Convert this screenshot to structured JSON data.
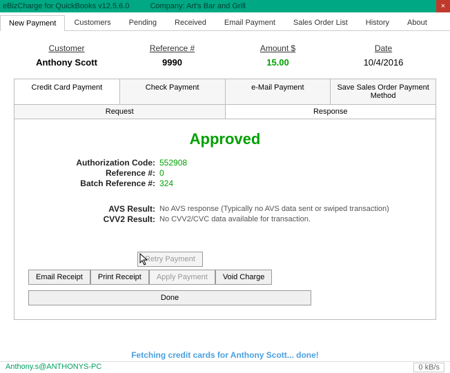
{
  "window": {
    "title1": "eBizCharge for QuickBooks v12.5.6.0",
    "title2": "Company: Art's Bar and Grill",
    "close": "×"
  },
  "main_tabs": [
    {
      "label": "New Payment",
      "active": true
    },
    {
      "label": "Customers",
      "active": false
    },
    {
      "label": "Pending",
      "active": false
    },
    {
      "label": "Received",
      "active": false
    },
    {
      "label": "Email Payment",
      "active": false
    },
    {
      "label": "Sales Order List",
      "active": false
    },
    {
      "label": "History",
      "active": false
    },
    {
      "label": "About",
      "active": false
    }
  ],
  "summary": {
    "customer_head": "Customer",
    "customer_val": "Anthony Scott",
    "ref_head": "Reference #",
    "ref_val": "9990",
    "amount_head": "Amount $",
    "amount_val": "15.00",
    "date_head": "Date",
    "date_val": "10/4/2016"
  },
  "pay_tabs": [
    {
      "label": "Credit Card Payment",
      "active": true
    },
    {
      "label": "Check Payment",
      "active": false
    },
    {
      "label": "e-Mail Payment",
      "active": false
    },
    {
      "label": "Save Sales Order Payment Method",
      "active": false
    }
  ],
  "sub_tabs": [
    {
      "label": "Request",
      "active": false
    },
    {
      "label": "Response",
      "active": true
    }
  ],
  "response": {
    "status": "Approved",
    "rows": [
      {
        "lbl": "Authorization Code:",
        "val": "552908",
        "cls": "val"
      },
      {
        "lbl": "Reference #:",
        "val": "0",
        "cls": "val"
      },
      {
        "lbl": "Batch Reference #:",
        "val": "324",
        "cls": "val"
      }
    ],
    "rows2": [
      {
        "lbl": "AVS Result:",
        "val": "No AVS response (Typically no AVS data sent or swiped transaction)",
        "cls": "val gray"
      },
      {
        "lbl": "CVV2 Result:",
        "val": "No CVV2/CVC data available for transaction.",
        "cls": "val gray"
      }
    ]
  },
  "buttons": {
    "retry": "Retry Payment",
    "email": "Email Receipt",
    "print": "Print Receipt",
    "apply": "Apply Payment",
    "void": "Void Charge",
    "done": "Done"
  },
  "footer": {
    "msg": "Fetching credit cards for Anthony Scott... done!",
    "user": "Anthony.s@ANTHONYS-PC",
    "speed": "0 kB/s"
  }
}
